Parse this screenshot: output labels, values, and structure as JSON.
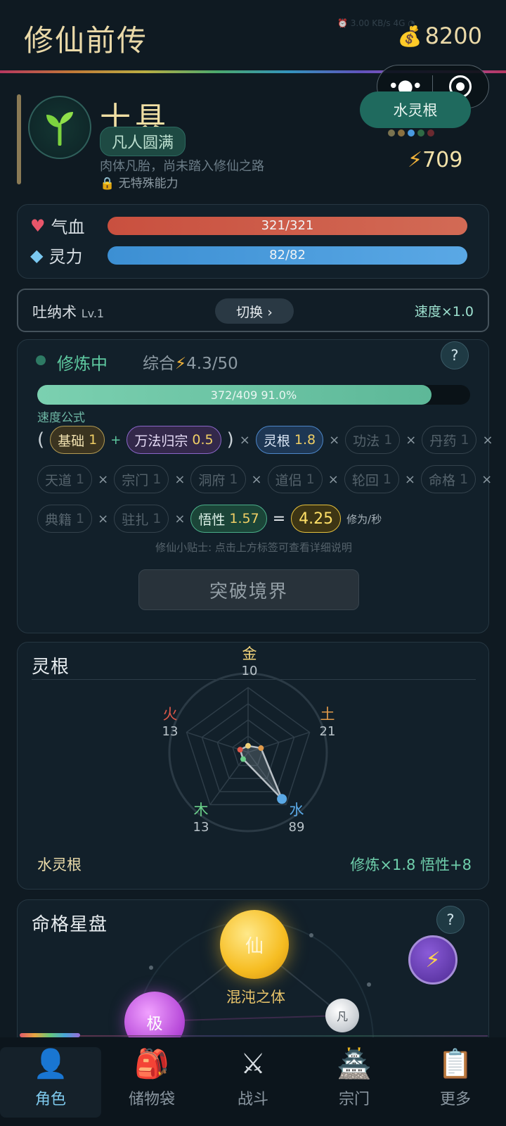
{
  "header": {
    "title": "修仙前传",
    "money": "8200"
  },
  "profile": {
    "name": "十具",
    "realm": "凡人圆满",
    "description": "肉体凡胎，尚未踏入修仙之路",
    "ability": "无特殊能力",
    "spirit_root_badge": "水灵根",
    "power": "709"
  },
  "vitals": {
    "hp_label": "气血",
    "hp_text": "321/321",
    "hp_fraction": 1.0,
    "mp_label": "灵力",
    "mp_text": "82/82",
    "mp_fraction": 1.0
  },
  "breathing": {
    "name": "吐纳术",
    "level": "Lv.1",
    "switch_label": "切换 ›",
    "speed": "速度×1.0"
  },
  "cultivation": {
    "state": "修炼中",
    "total_label": "综合",
    "total_value": "4.3/50",
    "help": "?",
    "progress_text": "372/409  91.0%",
    "progress_fraction": 0.91,
    "formula_label": "速度公式",
    "chips": {
      "base": {
        "label": "基础",
        "value": "1"
      },
      "wanfa": {
        "label": "万法归宗",
        "value": "0.5"
      },
      "linggen": {
        "label": "灵根",
        "value": "1.8"
      },
      "gongfa": {
        "label": "功法",
        "value": "1"
      },
      "danyao": {
        "label": "丹药",
        "value": "1"
      },
      "tiandao": {
        "label": "天道",
        "value": "1"
      },
      "zongmen": {
        "label": "宗门",
        "value": "1"
      },
      "dongfu": {
        "label": "洞府",
        "value": "1"
      },
      "daolv": {
        "label": "道侣",
        "value": "1"
      },
      "lunhui": {
        "label": "轮回",
        "value": "1"
      },
      "mingge": {
        "label": "命格",
        "value": "1"
      },
      "dianji": {
        "label": "典籍",
        "value": "1"
      },
      "zhuzha": {
        "label": "驻扎",
        "value": "1"
      },
      "wuxing": {
        "label": "悟性",
        "value": "1.57"
      }
    },
    "result": "4.25",
    "unit": "修为/秒",
    "tip": "修仙小贴士: 点击上方标签可查看详细说明",
    "breakthrough": "突破境界"
  },
  "spirit_roots": {
    "title": "灵根",
    "elements": [
      {
        "name": "金",
        "value": 10,
        "color": "#f0d27a"
      },
      {
        "name": "土",
        "value": 21,
        "color": "#e09a4a"
      },
      {
        "name": "水",
        "value": 89,
        "color": "#5aa8e5"
      },
      {
        "name": "木",
        "value": 13,
        "color": "#6ad08a"
      },
      {
        "name": "火",
        "value": 13,
        "color": "#e0584a"
      }
    ],
    "root_type": "水灵根",
    "bonus": "修炼×1.8  悟性+8"
  },
  "star_chart": {
    "title": "命格星盘",
    "help": "?",
    "orb_xian": "仙",
    "orb_ji": "极",
    "orb_fan": "凡",
    "body_type": "混沌之体"
  },
  "nav": [
    {
      "label": "角色",
      "icon": "person-icon"
    },
    {
      "label": "储物袋",
      "icon": "backpack-icon"
    },
    {
      "label": "战斗",
      "icon": "swords-icon"
    },
    {
      "label": "宗门",
      "icon": "pagoda-icon"
    },
    {
      "label": "更多",
      "icon": "clipboard-icon"
    }
  ]
}
